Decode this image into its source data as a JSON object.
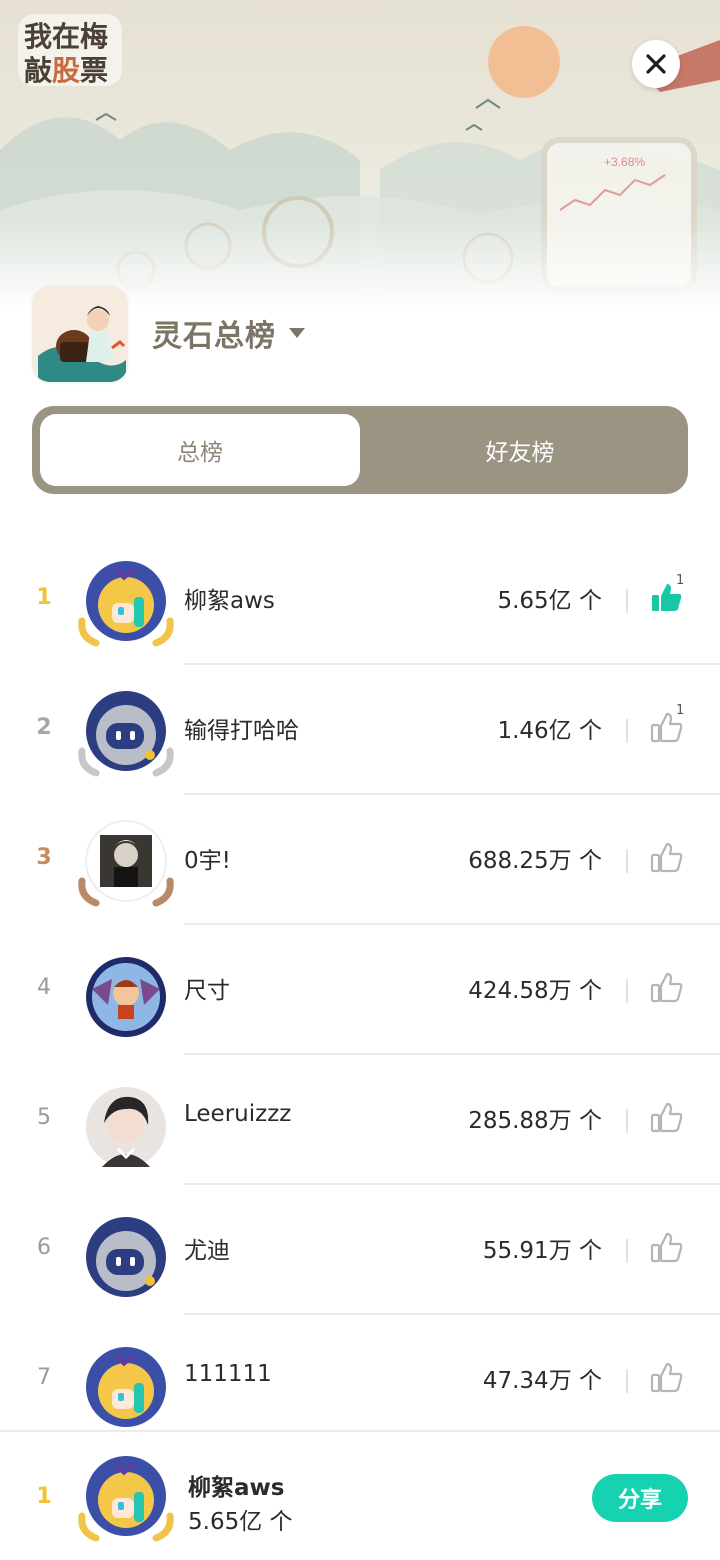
{
  "header": {
    "logo_text": "我在梅敲股票",
    "board_title": "灵石总榜",
    "chart_badge": "+3.68%"
  },
  "tabs": [
    {
      "label": "总榜",
      "active": true
    },
    {
      "label": "好友榜",
      "active": false
    }
  ],
  "unit": "个",
  "ranking": [
    {
      "rank": "1",
      "name": "柳絮aws",
      "score": "5.65亿 个",
      "likes": "1",
      "liked": true,
      "avatar": "blonde-girl"
    },
    {
      "rank": "2",
      "name": "输得打哈哈",
      "score": "1.46亿 个",
      "likes": "1",
      "liked": false,
      "avatar": "robot"
    },
    {
      "rank": "3",
      "name": "0宇!",
      "score": "688.25万 个",
      "likes": "",
      "liked": false,
      "avatar": "photo"
    },
    {
      "rank": "4",
      "name": "尺寸",
      "score": "424.58万 个",
      "likes": "",
      "liked": false,
      "avatar": "cartoon-bat"
    },
    {
      "rank": "5",
      "name": "Leeruizzz",
      "score": "285.88万 个",
      "likes": "",
      "liked": false,
      "avatar": "anime-boy"
    },
    {
      "rank": "6",
      "name": "尤迪",
      "score": "55.91万 个",
      "likes": "",
      "liked": false,
      "avatar": "robot"
    },
    {
      "rank": "7",
      "name": "111111",
      "score": "47.34万 个",
      "likes": "",
      "liked": false,
      "avatar": "blonde-girl"
    }
  ],
  "me": {
    "rank": "1",
    "name": "柳絮aws",
    "score": "5.65亿 个",
    "share_label": "分享"
  },
  "colors": {
    "accent": "#17d2b0",
    "tab_bg": "#9b9483",
    "title": "#7c7565",
    "gold": "#f2c233",
    "silver": "#a7a7a7",
    "bronze": "#c58a5e"
  },
  "icons": {
    "close": "close-icon",
    "dropdown": "caret-down-icon",
    "like": "thumbs-up-icon"
  }
}
